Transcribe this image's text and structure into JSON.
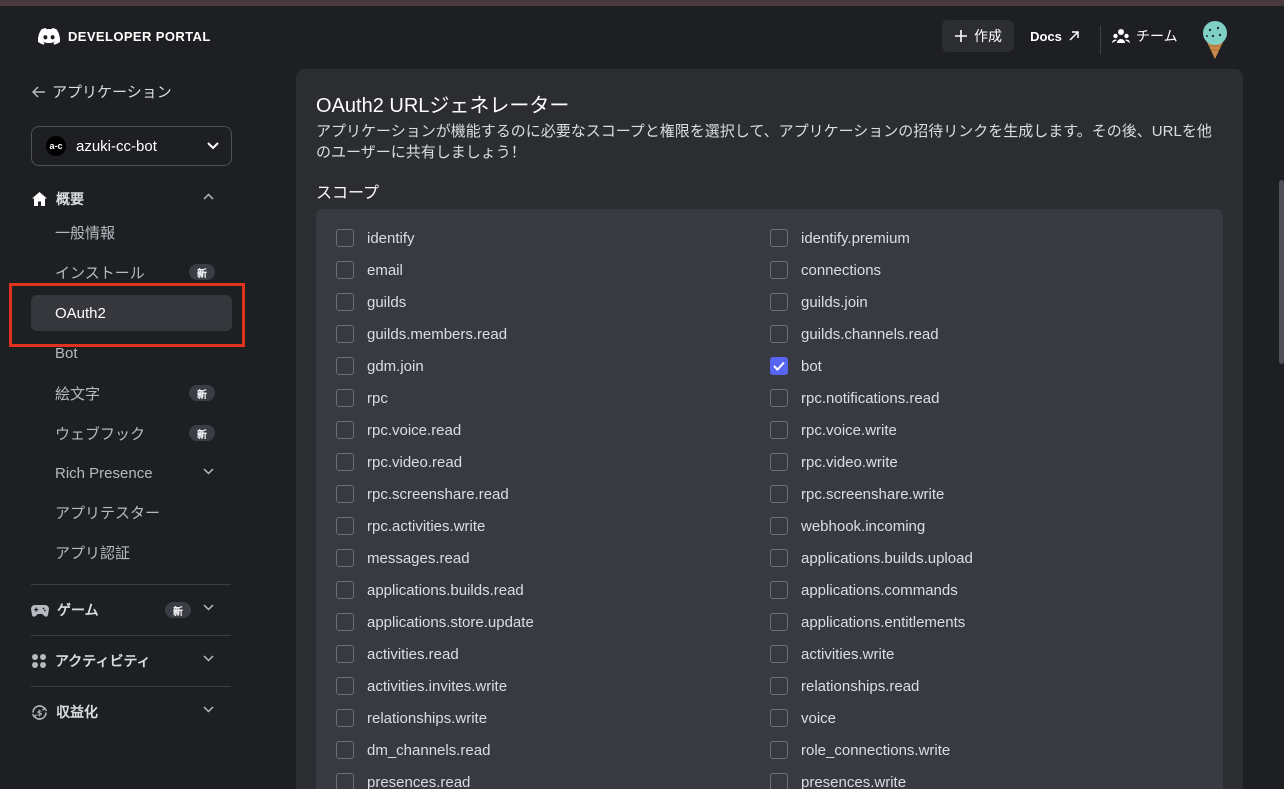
{
  "header": {
    "brand": "DEVELOPER PORTAL",
    "create_label": "作成",
    "docs_label": "Docs",
    "team_label": "チーム"
  },
  "sidebar": {
    "back_label": "アプリケーション",
    "app_avatar": "a-c",
    "app_name": "azuki-cc-bot",
    "overview_label": "概要",
    "items": [
      {
        "label": "一般情報",
        "new": false
      },
      {
        "label": "インストール",
        "new": true,
        "badge": "新"
      },
      {
        "label": "OAuth2",
        "new": false,
        "active": true
      },
      {
        "label": "Bot",
        "new": false
      },
      {
        "label": "絵文字",
        "new": true,
        "badge": "新"
      },
      {
        "label": "ウェブフック",
        "new": true,
        "badge": "新"
      },
      {
        "label": "Rich Presence",
        "new": false
      },
      {
        "label": "アプリテスター",
        "new": false
      },
      {
        "label": "アプリ認証",
        "new": false
      }
    ],
    "games_label": "ゲーム",
    "games_badge": "新",
    "activities_label": "アクティビティ",
    "monetization_label": "収益化"
  },
  "main": {
    "title": "OAuth2 URLジェネレーター",
    "description": "アプリケーションが機能するのに必要なスコープと権限を選択して、アプリケーションの招待リンクを生成します。その後、URLを他のユーザーに共有しましょう！",
    "scopes_label": "スコープ",
    "scopes_left": [
      {
        "name": "identify",
        "checked": false
      },
      {
        "name": "email",
        "checked": false
      },
      {
        "name": "guilds",
        "checked": false
      },
      {
        "name": "guilds.members.read",
        "checked": false
      },
      {
        "name": "gdm.join",
        "checked": false
      },
      {
        "name": "rpc",
        "checked": false
      },
      {
        "name": "rpc.voice.read",
        "checked": false
      },
      {
        "name": "rpc.video.read",
        "checked": false
      },
      {
        "name": "rpc.screenshare.read",
        "checked": false
      },
      {
        "name": "rpc.activities.write",
        "checked": false
      },
      {
        "name": "messages.read",
        "checked": false
      },
      {
        "name": "applications.builds.read",
        "checked": false
      },
      {
        "name": "applications.store.update",
        "checked": false
      },
      {
        "name": "activities.read",
        "checked": false
      },
      {
        "name": "activities.invites.write",
        "checked": false
      },
      {
        "name": "relationships.write",
        "checked": false
      },
      {
        "name": "dm_channels.read",
        "checked": false
      },
      {
        "name": "presences.read",
        "checked": false
      }
    ],
    "scopes_right": [
      {
        "name": "identify.premium",
        "checked": false
      },
      {
        "name": "connections",
        "checked": false
      },
      {
        "name": "guilds.join",
        "checked": false
      },
      {
        "name": "guilds.channels.read",
        "checked": false
      },
      {
        "name": "bot",
        "checked": true
      },
      {
        "name": "rpc.notifications.read",
        "checked": false
      },
      {
        "name": "rpc.voice.write",
        "checked": false
      },
      {
        "name": "rpc.video.write",
        "checked": false
      },
      {
        "name": "rpc.screenshare.write",
        "checked": false
      },
      {
        "name": "webhook.incoming",
        "checked": false
      },
      {
        "name": "applications.builds.upload",
        "checked": false
      },
      {
        "name": "applications.commands",
        "checked": false
      },
      {
        "name": "applications.entitlements",
        "checked": false
      },
      {
        "name": "activities.write",
        "checked": false
      },
      {
        "name": "relationships.read",
        "checked": false
      },
      {
        "name": "voice",
        "checked": false
      },
      {
        "name": "role_connections.write",
        "checked": false
      },
      {
        "name": "presences.write",
        "checked": false
      }
    ]
  },
  "colors": {
    "accent": "#5865f2",
    "highlight": "#e0321f",
    "background": "#1e1f22",
    "panel": "#2b2d31"
  }
}
